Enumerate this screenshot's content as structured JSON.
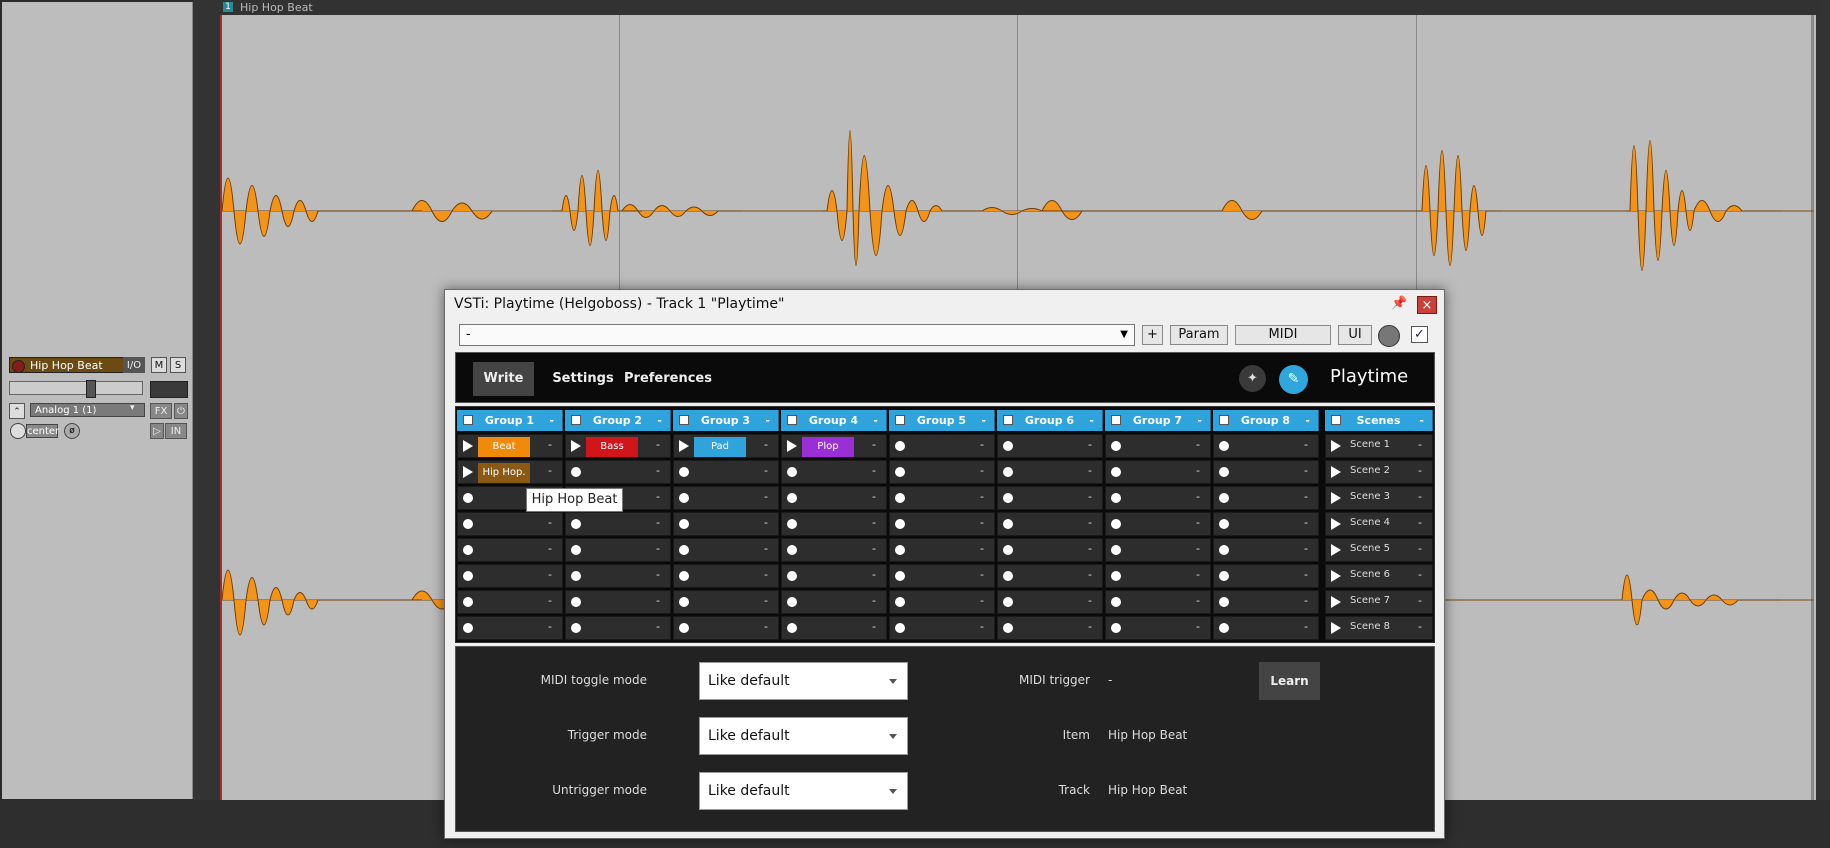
{
  "track": {
    "name": "Hip Hop Beat",
    "io_label": "I/O",
    "mute_label": "M",
    "solo_label": "S",
    "input_label": "Analog 1 (1)",
    "fx_label": "FX",
    "pan_label": "center",
    "in_label": "IN"
  },
  "item": {
    "number": "1",
    "name": "Hip Hop Beat"
  },
  "window": {
    "title": "VSTi: Playtime (Helgoboss) - Track 1 \"Playtime\"",
    "close_label": "×",
    "pin_icon": "pin-icon",
    "preset_value": "-",
    "add_label": "+",
    "param_label": "Param",
    "midi_label": "MIDI",
    "ui_label": "UI"
  },
  "plugin": {
    "tabs": [
      "Write",
      "Settings",
      "Preferences"
    ],
    "brand": "Playtime",
    "accent": "#2fa3db",
    "groups": [
      {
        "name": "Group 1",
        "dash": "-"
      },
      {
        "name": "Group 2",
        "dash": "-"
      },
      {
        "name": "Group 3",
        "dash": "-"
      },
      {
        "name": "Group 4",
        "dash": "-"
      },
      {
        "name": "Group 5",
        "dash": "-"
      },
      {
        "name": "Group 6",
        "dash": "-"
      },
      {
        "name": "Group 7",
        "dash": "-"
      },
      {
        "name": "Group 8",
        "dash": "-"
      }
    ],
    "scenes_header": {
      "name": "Scenes",
      "dash": "-"
    },
    "scenes": [
      "Scene 1",
      "Scene 2",
      "Scene 3",
      "Scene 4",
      "Scene 5",
      "Scene 6",
      "Scene 7",
      "Scene 8"
    ],
    "clips": [
      {
        "label": "Beat",
        "color": "#f08a0a"
      },
      {
        "label": "Bass",
        "color": "#d0161b"
      },
      {
        "label": "Pad",
        "color": "#2fa3db"
      },
      {
        "label": "Plop",
        "color": "#9b2fd6"
      },
      {
        "label": "Hip Hop.",
        "color": "#8a5a14"
      }
    ],
    "slot_dash": "-",
    "tooltip": "Hip Hop Beat"
  },
  "properties": {
    "midi_toggle_mode_label": "MIDI toggle mode",
    "midi_toggle_mode_value": "Like default",
    "trigger_mode_label": "Trigger mode",
    "trigger_mode_value": "Like default",
    "untrigger_mode_label": "Untrigger mode",
    "untrigger_mode_value": "Like default",
    "midi_trigger_label": "MIDI trigger",
    "midi_trigger_value": "-",
    "learn_label": "Learn",
    "item_label": "Item",
    "item_value": "Hip Hop Beat",
    "track_label": "Track",
    "track_value": "Hip Hop Beat"
  }
}
